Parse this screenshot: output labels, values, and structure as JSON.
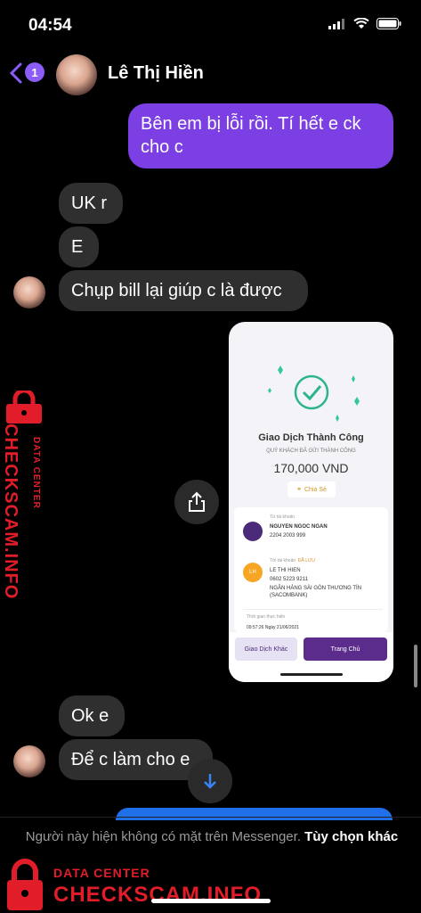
{
  "status": {
    "time": "04:54"
  },
  "header": {
    "back_badge": "1",
    "contact_name": "Lê Thị Hiền"
  },
  "messages": {
    "m1": "Bên em bị lỗi rồi. Tí hết e ck cho c",
    "m2": "UK r",
    "m3": "E",
    "m4": "Chụp bill lại giúp c là được",
    "m5": "Ok e",
    "m6": "Để c làm cho e"
  },
  "receipt": {
    "title": "Giao Dịch Thành Công",
    "subtitle": "QUÝ KHÁCH ĐÃ GỬI THÀNH CÔNG",
    "amount": "170,000 VND",
    "share_label": "Chia Sẻ",
    "from_label": "Từ tài khoản",
    "from_name": "NGUYEN NGOC NGAN",
    "from_account": "2204 2003 999",
    "to_label": "Tới tài khoản",
    "saved_label": "ĐÃ LƯU",
    "to_initials": "LH",
    "to_name": "LE THI HIEN",
    "to_account": "0602 5223 9211",
    "to_bank": "NGÂN HÀNG SÀI GÒN THƯƠNG TÍN (SACOMBANK)",
    "time_label": "Thời gian thực hiện",
    "time_value": "09:57:26  Ngày 21/06/2021",
    "btn_other": "Giao Dịch Khác",
    "btn_home": "Trang Chủ"
  },
  "footer": {
    "notice": "Người này hiện không có mặt trên Messenger.",
    "notice_link": "Tùy chọn khác"
  },
  "watermark": {
    "line1": "DATA CENTER",
    "line2": "CHECKSCAM.INFO"
  },
  "colors": {
    "accent": "#7b3fe4",
    "incoming": "#2f2f2f",
    "watermark": "#e11d2a"
  }
}
